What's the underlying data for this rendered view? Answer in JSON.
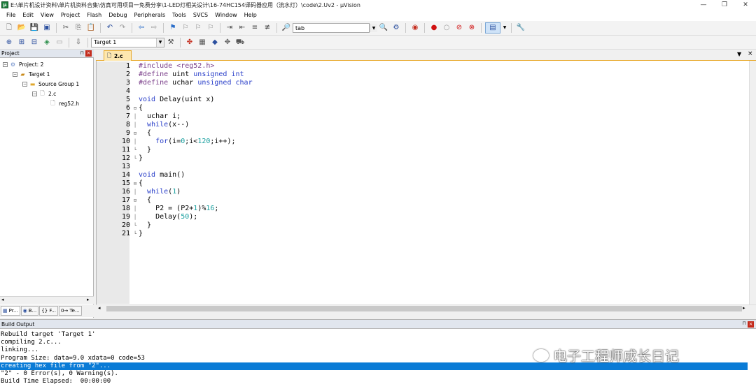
{
  "window": {
    "title": "E:\\单片机设计资料\\单片机资料合集\\仿真可用项目一免费分享\\1-LED灯相关设计\\16-74HC154译码器应用（流水灯）\\code\\2.Uv2 - µVision",
    "app_icon_label": "μ"
  },
  "menu": [
    "File",
    "Edit",
    "View",
    "Project",
    "Flash",
    "Debug",
    "Peripherals",
    "Tools",
    "SVCS",
    "Window",
    "Help"
  ],
  "toolbar": {
    "find_combo": "tab",
    "target_combo": "Target 1"
  },
  "project_panel": {
    "title": "Project",
    "tree": [
      {
        "label": "Project: 2",
        "depth": 0,
        "toggle": "−",
        "icon": "project-icon"
      },
      {
        "label": "Target 1",
        "depth": 1,
        "toggle": "−",
        "icon": "target-icon"
      },
      {
        "label": "Source Group 1",
        "depth": 2,
        "toggle": "−",
        "icon": "folder-icon"
      },
      {
        "label": "2.c",
        "depth": 3,
        "toggle": "−",
        "icon": "file-icon"
      },
      {
        "label": "reg52.h",
        "depth": 4,
        "toggle": "",
        "icon": "file-icon"
      }
    ],
    "tabs": [
      "Pr...",
      "B...",
      "{} F...",
      "0→ Te..."
    ]
  },
  "editor": {
    "tab_label": "2.c",
    "lines": [
      {
        "n": "1",
        "fold": "",
        "code": "#include <reg52.h>"
      },
      {
        "n": "2",
        "fold": "",
        "code": "#define uint unsigned int"
      },
      {
        "n": "3",
        "fold": "",
        "code": "#define uchar unsigned char"
      },
      {
        "n": "4",
        "fold": "",
        "code": ""
      },
      {
        "n": "5",
        "fold": "",
        "code": "void Delay(uint x)"
      },
      {
        "n": "6",
        "fold": "⊟",
        "code": "{"
      },
      {
        "n": "7",
        "fold": "│",
        "code": "  uchar i;"
      },
      {
        "n": "8",
        "fold": "│",
        "code": "  while(x--)"
      },
      {
        "n": "9",
        "fold": "⊟",
        "code": "  {"
      },
      {
        "n": "10",
        "fold": "│",
        "code": "    for(i=0;i<120;i++);"
      },
      {
        "n": "11",
        "fold": "└",
        "code": "  }"
      },
      {
        "n": "12",
        "fold": "└",
        "code": "}"
      },
      {
        "n": "13",
        "fold": "",
        "code": ""
      },
      {
        "n": "14",
        "fold": "",
        "code": "void main()"
      },
      {
        "n": "15",
        "fold": "⊟",
        "code": "{"
      },
      {
        "n": "16",
        "fold": "│",
        "code": "  while(1)"
      },
      {
        "n": "17",
        "fold": "⊟",
        "code": "  {"
      },
      {
        "n": "18",
        "fold": "│",
        "code": "    P2 = (P2+1)%16;"
      },
      {
        "n": "19",
        "fold": "│",
        "code": "    Delay(50);"
      },
      {
        "n": "20",
        "fold": "└",
        "code": "  }"
      },
      {
        "n": "21",
        "fold": "└",
        "code": "}"
      }
    ]
  },
  "build_output": {
    "title": "Build Output",
    "lines": [
      "Rebuild target 'Target 1'",
      "compiling 2.c...",
      "linking...",
      "Program Size: data=9.0 xdata=0 code=53",
      "creating hex file from \"2\"...",
      "\"2\" - 0 Error(s), 0 Warning(s).",
      "Build Time Elapsed:  00:00:00"
    ],
    "selected_index": 4
  },
  "watermark": "电子工程师成长日记"
}
